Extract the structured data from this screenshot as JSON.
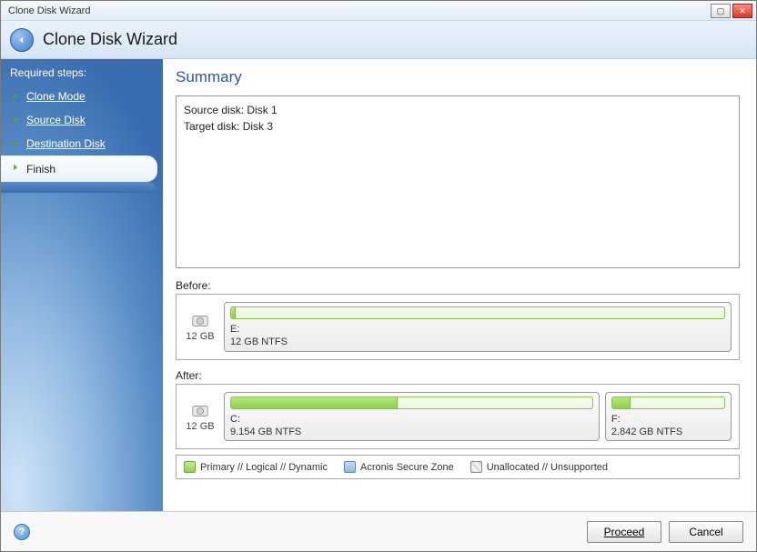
{
  "titlebar": {
    "title": "Clone Disk Wizard"
  },
  "header": {
    "title": "Clone Disk Wizard"
  },
  "sidebar": {
    "heading": "Required steps:",
    "steps": {
      "clone_mode": "Clone Mode",
      "source_disk": "Source Disk",
      "destination_disk": "Destination Disk",
      "finish": "Finish"
    }
  },
  "content": {
    "title": "Summary",
    "source_line": "Source disk: Disk 1",
    "target_line": "Target disk: Disk 3",
    "before_label": "Before:",
    "after_label": "After:"
  },
  "before": {
    "disk_size": "12 GB",
    "partitions": [
      {
        "letter": "E:",
        "desc": "12 GB  NTFS",
        "fill_pct": 1,
        "width_pct": 100
      }
    ]
  },
  "after": {
    "disk_size": "12 GB",
    "partitions": [
      {
        "letter": "C:",
        "desc": "9.154 GB  NTFS",
        "fill_pct": 46,
        "width_pct": 74
      },
      {
        "letter": "F:",
        "desc": "2.842 GB  NTFS",
        "fill_pct": 16,
        "width_pct": 26
      }
    ]
  },
  "legend": {
    "primary": "Primary // Logical // Dynamic",
    "secure": "Acronis Secure Zone",
    "unallocated": "Unallocated // Unsupported"
  },
  "footer": {
    "proceed": "Proceed",
    "cancel": "Cancel"
  }
}
